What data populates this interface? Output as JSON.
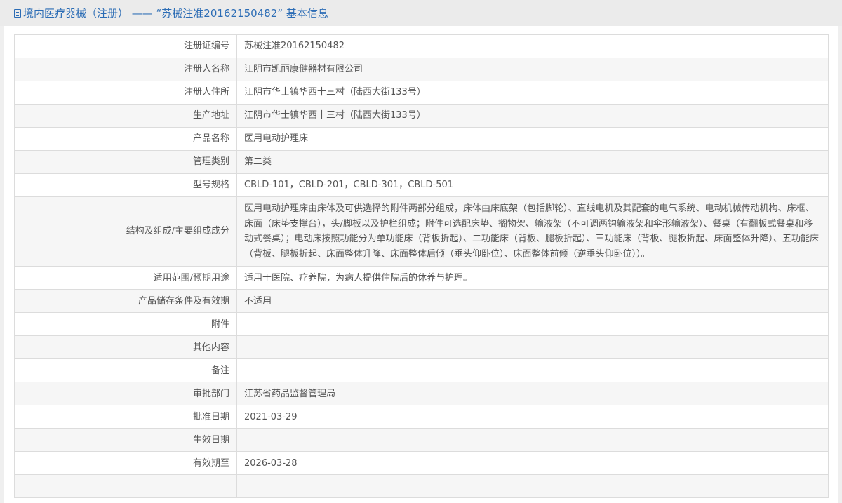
{
  "header": {
    "title": "境内医疗器械（注册） —— “苏械注准20162150482” 基本信息"
  },
  "rows": [
    {
      "label": "注册证编号",
      "value": "苏械注准20162150482"
    },
    {
      "label": "注册人名称",
      "value": "江阴市凯丽康健器材有限公司"
    },
    {
      "label": "注册人住所",
      "value": "江阴市华士镇华西十三村（陆西大街133号）"
    },
    {
      "label": "生产地址",
      "value": "江阴市华士镇华西十三村（陆西大街133号）"
    },
    {
      "label": "产品名称",
      "value": "医用电动护理床"
    },
    {
      "label": "管理类别",
      "value": "第二类"
    },
    {
      "label": "型号规格",
      "value": "CBLD-101，CBLD-201，CBLD-301，CBLD-501"
    },
    {
      "label": "结构及组成/主要组成成分",
      "value": "医用电动护理床由床体及可供选择的附件两部分组成，床体由床底架（包括脚轮）、直线电机及其配套的电气系统、电动机械传动机构、床框、床面（床垫支撑台），头/脚板以及护栏组成；附件可选配床垫、搁物架、输液架（不可调两钩输液架和伞形输液架）、餐桌（有翻板式餐桌和移动式餐桌）；电动床按照功能分为单功能床（背板折起）、二功能床（背板、腿板折起）、三功能床（背板、腿板折起、床面整体升降）、五功能床（背板、腿板折起、床面整体升降、床面整体后倾（垂头仰卧位）、床面整体前倾（逆垂头仰卧位））。"
    },
    {
      "label": "适用范围/预期用途",
      "value": "适用于医院、疗养院，为病人提供住院后的休养与护理。"
    },
    {
      "label": "产品储存条件及有效期",
      "value": "不适用"
    },
    {
      "label": "附件",
      "value": ""
    },
    {
      "label": "其他内容",
      "value": ""
    },
    {
      "label": "备注",
      "value": ""
    },
    {
      "label": "审批部门",
      "value": "江苏省药品监督管理局"
    },
    {
      "label": "批准日期",
      "value": "2021-03-29"
    },
    {
      "label": "生效日期",
      "value": ""
    },
    {
      "label": "有效期至",
      "value": "2026-03-28"
    },
    {
      "label": "",
      "value": ""
    }
  ]
}
